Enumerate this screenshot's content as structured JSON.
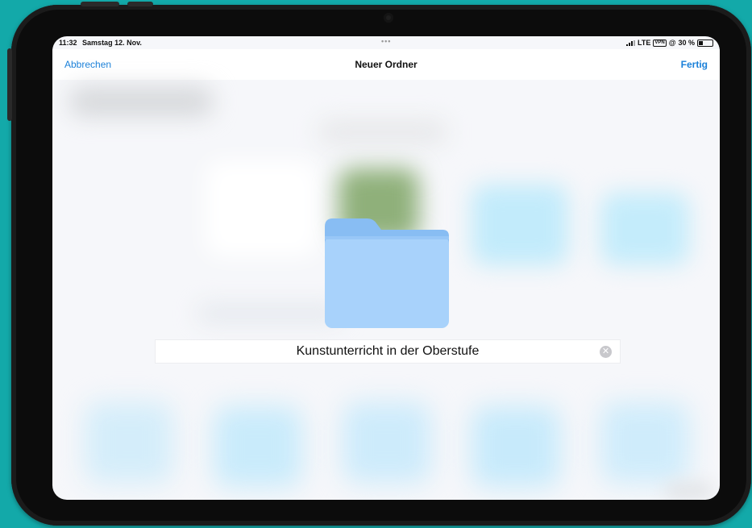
{
  "status_bar": {
    "time": "11:32",
    "date": "Samstag 12. Nov.",
    "multitask_dots": "•••",
    "network": "LTE",
    "vpn_badge": "VPN",
    "battery_percent": "30 %"
  },
  "nav": {
    "cancel_label": "Abbrechen",
    "title": "Neuer Ordner",
    "done_label": "Fertig"
  },
  "folder_name_field": {
    "value": "Kunstunterricht in der Oberstufe"
  },
  "icons": {
    "folder": "folder-icon",
    "clear": "clear-icon"
  },
  "colors": {
    "accent": "#1a80d9",
    "folder_front": "#a8d2fb",
    "folder_back": "#88bdf3",
    "device_background": "#13a9a9"
  }
}
